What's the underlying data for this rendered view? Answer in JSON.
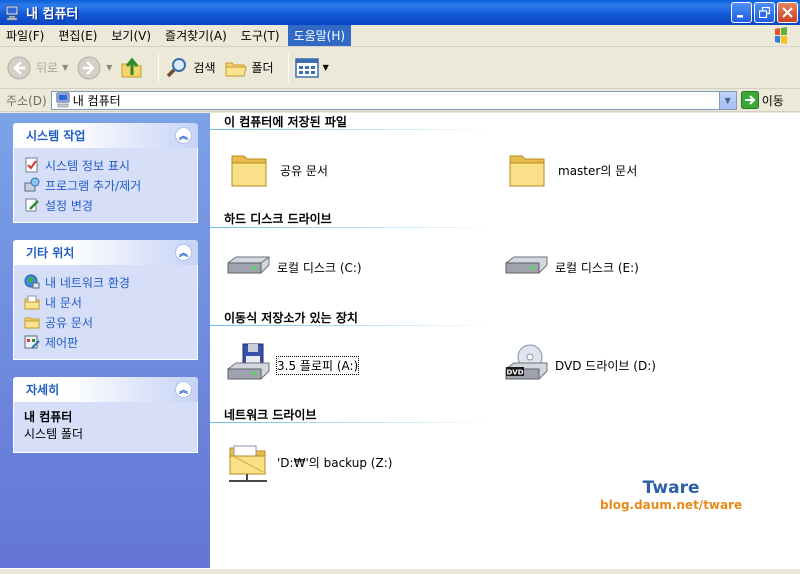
{
  "window": {
    "title": "내 컴퓨터"
  },
  "menu": {
    "items": [
      "파일(F)",
      "편집(E)",
      "보기(V)",
      "즐겨찾기(A)",
      "도구(T)",
      "도움말(H)"
    ],
    "active_index": 5
  },
  "toolbar": {
    "back_label": "뒤로",
    "search_label": "검색",
    "folders_label": "폴더"
  },
  "address": {
    "label": "주소(D)",
    "value": "내 컴퓨터",
    "go_label": "이동"
  },
  "taskpanes": {
    "system": {
      "title": "시스템 작업",
      "links": [
        "시스템 정보 표시",
        "프로그램 추가/제거",
        "설정 변경"
      ]
    },
    "other": {
      "title": "기타 위치",
      "links": [
        "내 네트워크 환경",
        "내 문서",
        "공유 문서",
        "제어판"
      ]
    },
    "details": {
      "title": "자세히",
      "name": "내 컴퓨터",
      "type": "시스템 폴더"
    }
  },
  "groups": {
    "stored_files": {
      "title": "이 컴퓨터에 저장된 파일",
      "items": [
        "공유 문서",
        "master의 문서"
      ]
    },
    "hard_disks": {
      "title": "하드 디스크 드라이브",
      "items": [
        "로컬 디스크 (C:)",
        "로컬 디스크 (E:)"
      ]
    },
    "removable": {
      "title": "이동식 저장소가 있는 장치",
      "items": [
        "3.5 플로피 (A:)",
        "DVD 드라이브 (D:)"
      ]
    },
    "network": {
      "title": "네트워크 드라이브",
      "items": [
        "'D:₩'의 backup (Z:)"
      ]
    }
  },
  "watermark": {
    "title": "Tware",
    "url": "blog.daum.net/tware"
  },
  "colors": {
    "title_bar": "#0a5fd8",
    "link": "#215dc6",
    "pane_bg": "#d6dff7",
    "left_gradient_top": "#7ba2e7",
    "left_gradient_bottom": "#6375d6"
  }
}
